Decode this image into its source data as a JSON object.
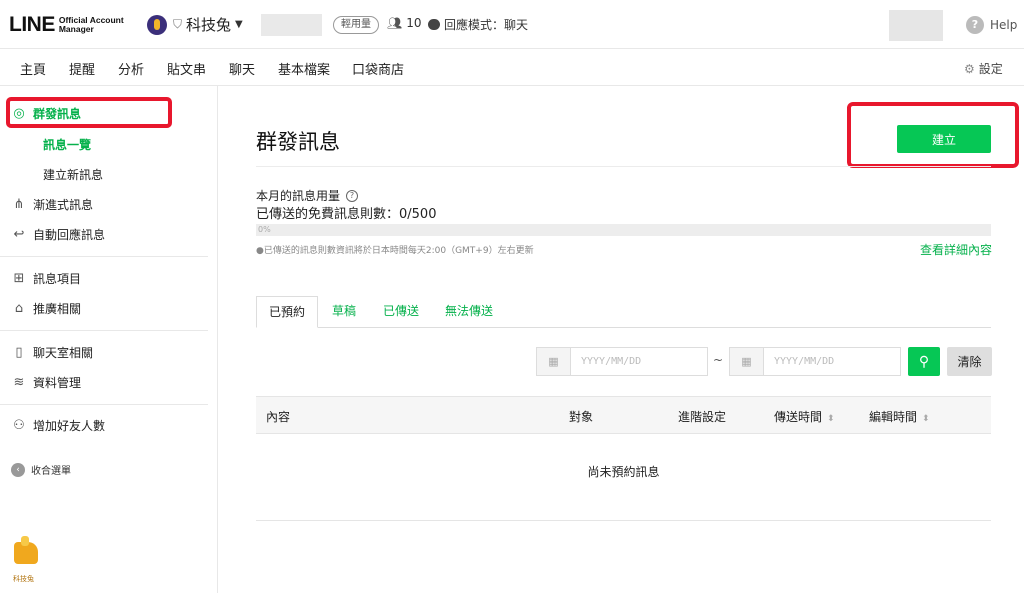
{
  "header": {
    "logo_big": "LINE",
    "logo_small_1": "Official Account",
    "logo_small_2": "Manager",
    "account_name": "科技兔",
    "plan_badge": "輕用量",
    "friend_count": "10",
    "reply_mode": "回應模式：聊天",
    "help_label": "Help"
  },
  "nav": {
    "items": [
      "主頁",
      "提醒",
      "分析",
      "貼文串",
      "聊天",
      "基本檔案",
      "口袋商店"
    ],
    "settings_label": "設定"
  },
  "sidebar": {
    "broadcast": "群發訊息",
    "sub_list": "訊息一覽",
    "sub_create": "建立新訊息",
    "step": "漸進式訊息",
    "auto_reply": "自動回應訊息",
    "message_items": "訊息項目",
    "promo": "推廣相關",
    "chatroom": "聊天室相關",
    "data_mgmt": "資料管理",
    "add_friends": "增加好友人數",
    "collapse": "收合選單",
    "mascot_label": "科技兔"
  },
  "main": {
    "title": "群發訊息",
    "create_label": "建立",
    "usage_label": "本月的訊息用量",
    "sent_count": "已傳送的免費訊息則數：0/500",
    "progress_pct": 0,
    "progress_text": "0%",
    "note": "●已傳送的訊息則數資訊將於日本時間每天2:00（GMT+9）左右更新",
    "detail_link": "查看詳細內容",
    "tabs": [
      "已預約",
      "草稿",
      "已傳送",
      "無法傳送"
    ],
    "date_placeholder": "YYYY/MM/DD",
    "tilde": "~",
    "clear_label": "清除",
    "table_headers": [
      "內容",
      "對象",
      "進階設定",
      "傳送時間",
      "編輯時間"
    ],
    "empty_text": "尚未預約訊息"
  },
  "colors": {
    "accent": "#06c755",
    "highlight": "#e8172d"
  }
}
